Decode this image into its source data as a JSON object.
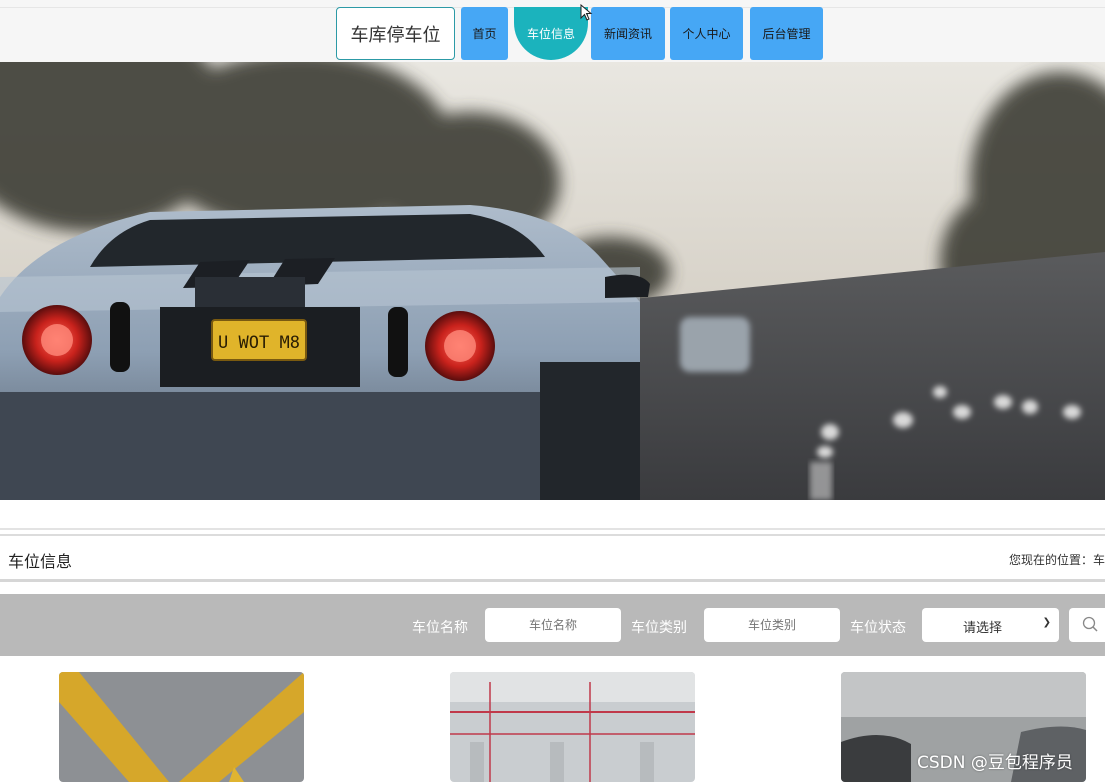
{
  "site": {
    "brand": "车库停车位"
  },
  "nav": [
    {
      "label": "首页",
      "active": false
    },
    {
      "label": "车位信息",
      "active": true
    },
    {
      "label": "新闻资讯",
      "active": false
    },
    {
      "label": "个人中心",
      "active": false
    },
    {
      "label": "后台管理",
      "active": false
    }
  ],
  "hero": {
    "plate": "U WOT M8"
  },
  "breadcrumb": {
    "title": "车位信息",
    "location": "您现在的位置：车"
  },
  "search": {
    "name_label": "车位名称",
    "name_placeholder": "车位名称",
    "type_label": "车位类别",
    "type_placeholder": "车位类别",
    "status_label": "车位状态",
    "status_value": "请选择",
    "button_icon": "search-icon"
  },
  "watermark": "CSDN @豆包程序员",
  "colors": {
    "nav": "#46a7f5",
    "nav_active": "#1bb3bd",
    "search_bar": "#b9b9b9"
  }
}
